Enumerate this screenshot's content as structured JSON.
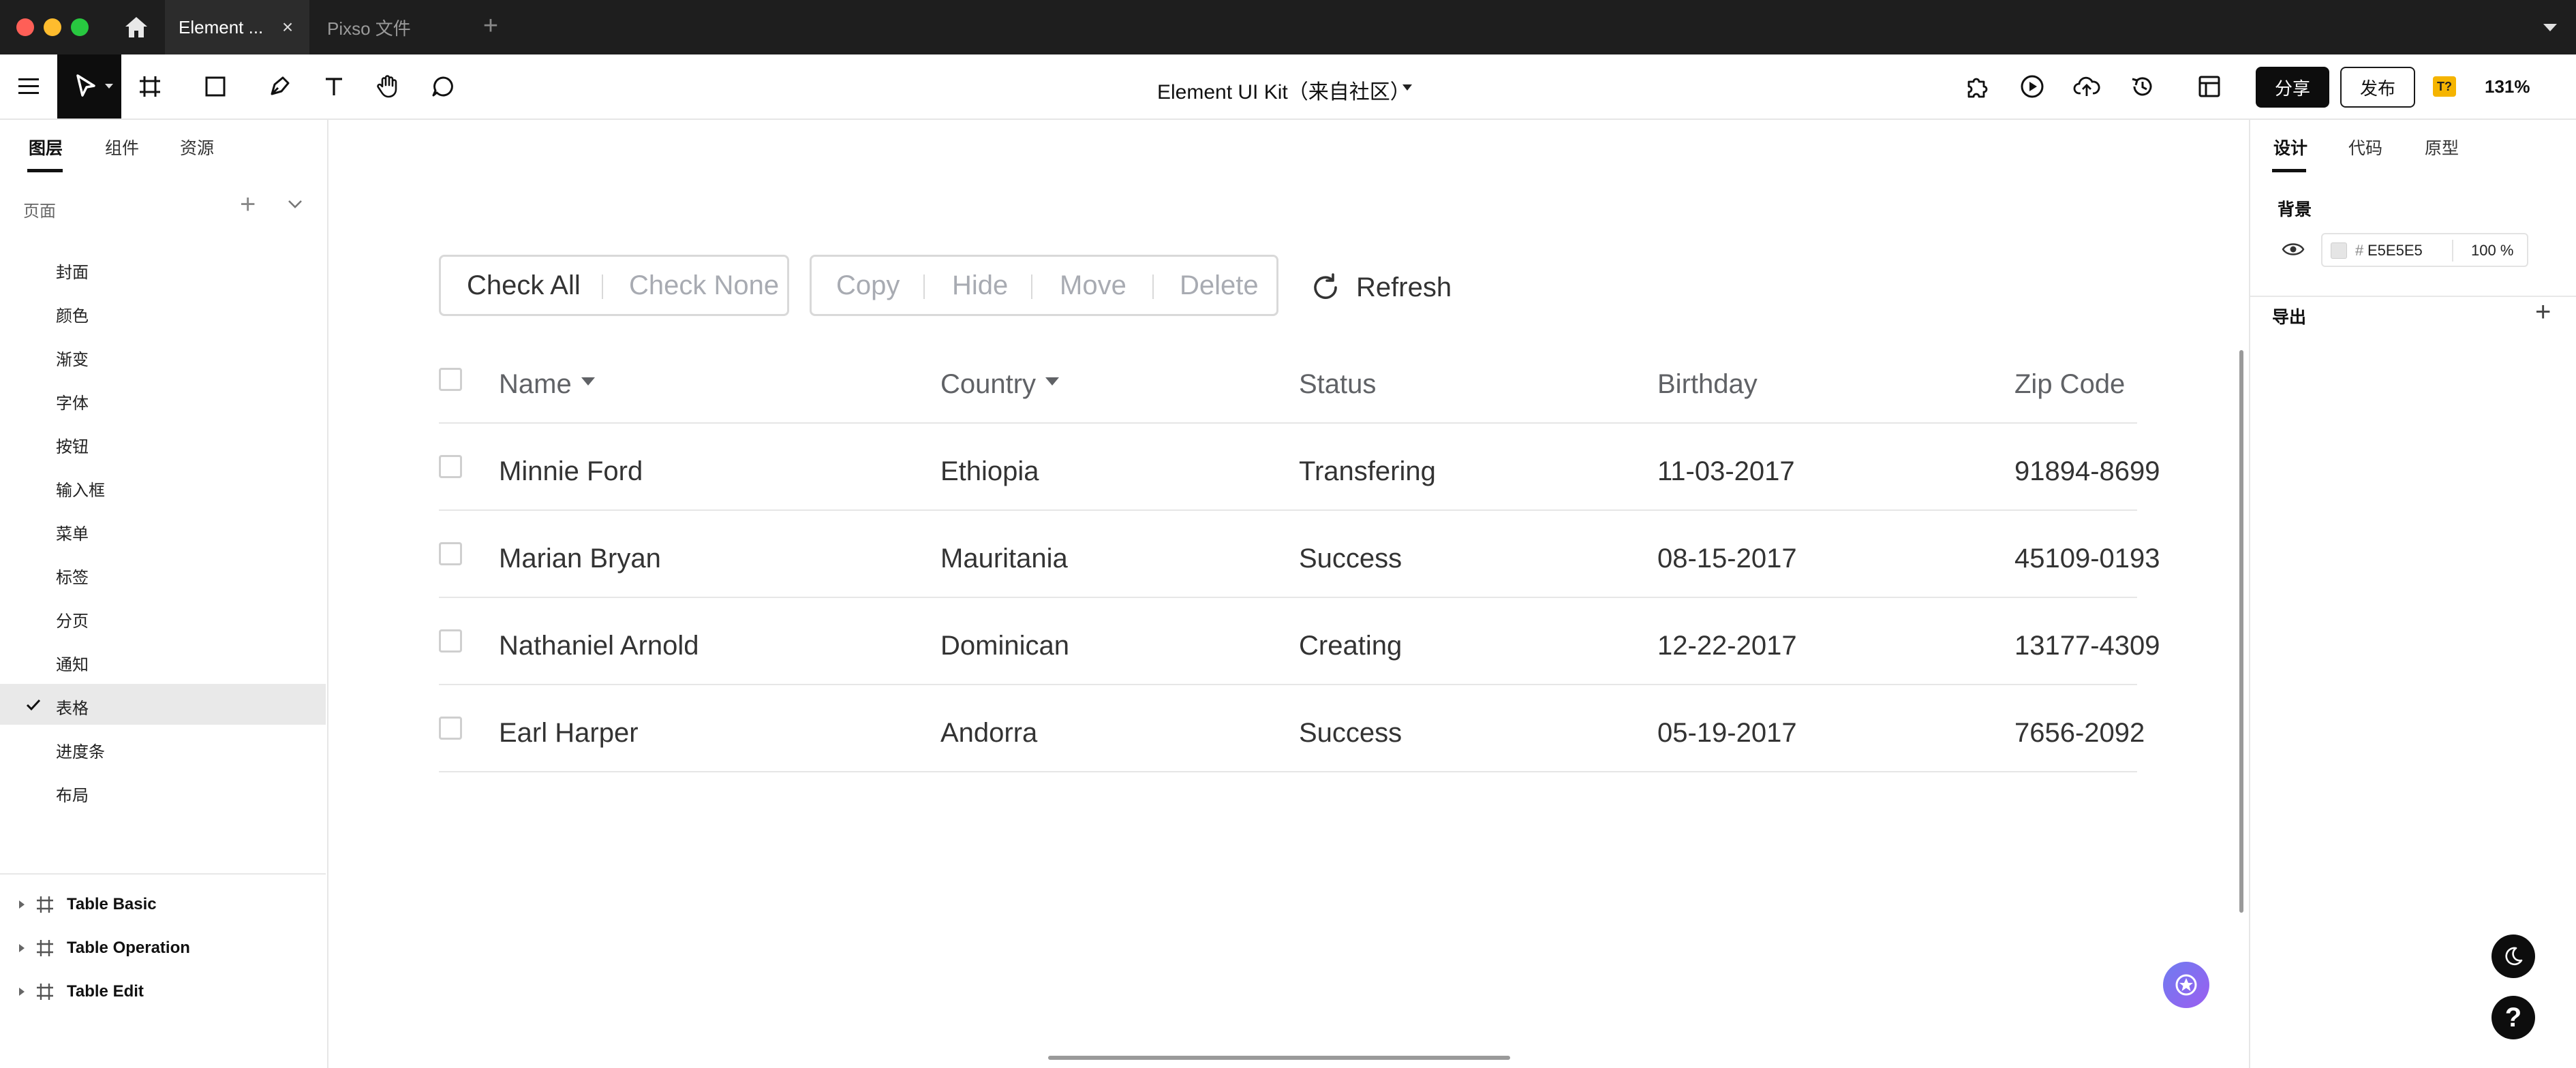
{
  "titlebar": {
    "tabs": [
      {
        "label": "Element ..."
      },
      {
        "label": "Pixso 文件"
      }
    ]
  },
  "toolbar": {
    "doc_title": "Element UI Kit（来自社区）",
    "share_label": "分享",
    "publish_label": "发布",
    "font_badge": "T?",
    "zoom": "131%"
  },
  "left_panel": {
    "tabs": [
      "图层",
      "组件",
      "资源"
    ],
    "pages_label": "页面",
    "pages": [
      "封面",
      "颜色",
      "渐变",
      "字体",
      "按钮",
      "输入框",
      "菜单",
      "标签",
      "分页",
      "通知",
      "表格",
      "进度条",
      "布局"
    ],
    "selected_page": "表格",
    "layers": [
      "Table Basic",
      "Table Operation",
      "Table Edit"
    ]
  },
  "canvas": {
    "group1": [
      "Check All",
      "Check None"
    ],
    "group2": [
      "Copy",
      "Hide",
      "Move",
      "Delete"
    ],
    "refresh_label": "Refresh",
    "table": {
      "headers": [
        "Name",
        "Country",
        "Status",
        "Birthday",
        "Zip Code"
      ],
      "rows": [
        [
          "Minnie Ford",
          "Ethiopia",
          "Transfering",
          "11-03-2017",
          "91894-8699"
        ],
        [
          "Marian Bryan",
          "Mauritania",
          "Success",
          "08-15-2017",
          "45109-0193"
        ],
        [
          "Nathaniel Arnold",
          "Dominican",
          "Creating",
          "12-22-2017",
          "13177-4309"
        ],
        [
          "Earl Harper",
          "Andorra",
          "Success",
          "05-19-2017",
          "7656-2092"
        ]
      ]
    }
  },
  "right_panel": {
    "tabs": [
      "设计",
      "代码",
      "原型"
    ],
    "background_title": "背景",
    "color_hash": "#",
    "color_hex": "E5E5E5",
    "opacity": "100 %",
    "export_title": "导出"
  },
  "colors": {
    "background_fill": "#E5E5E5",
    "traffic_red": "#ff5f57",
    "traffic_yellow": "#febc2e",
    "traffic_green": "#28c840"
  }
}
